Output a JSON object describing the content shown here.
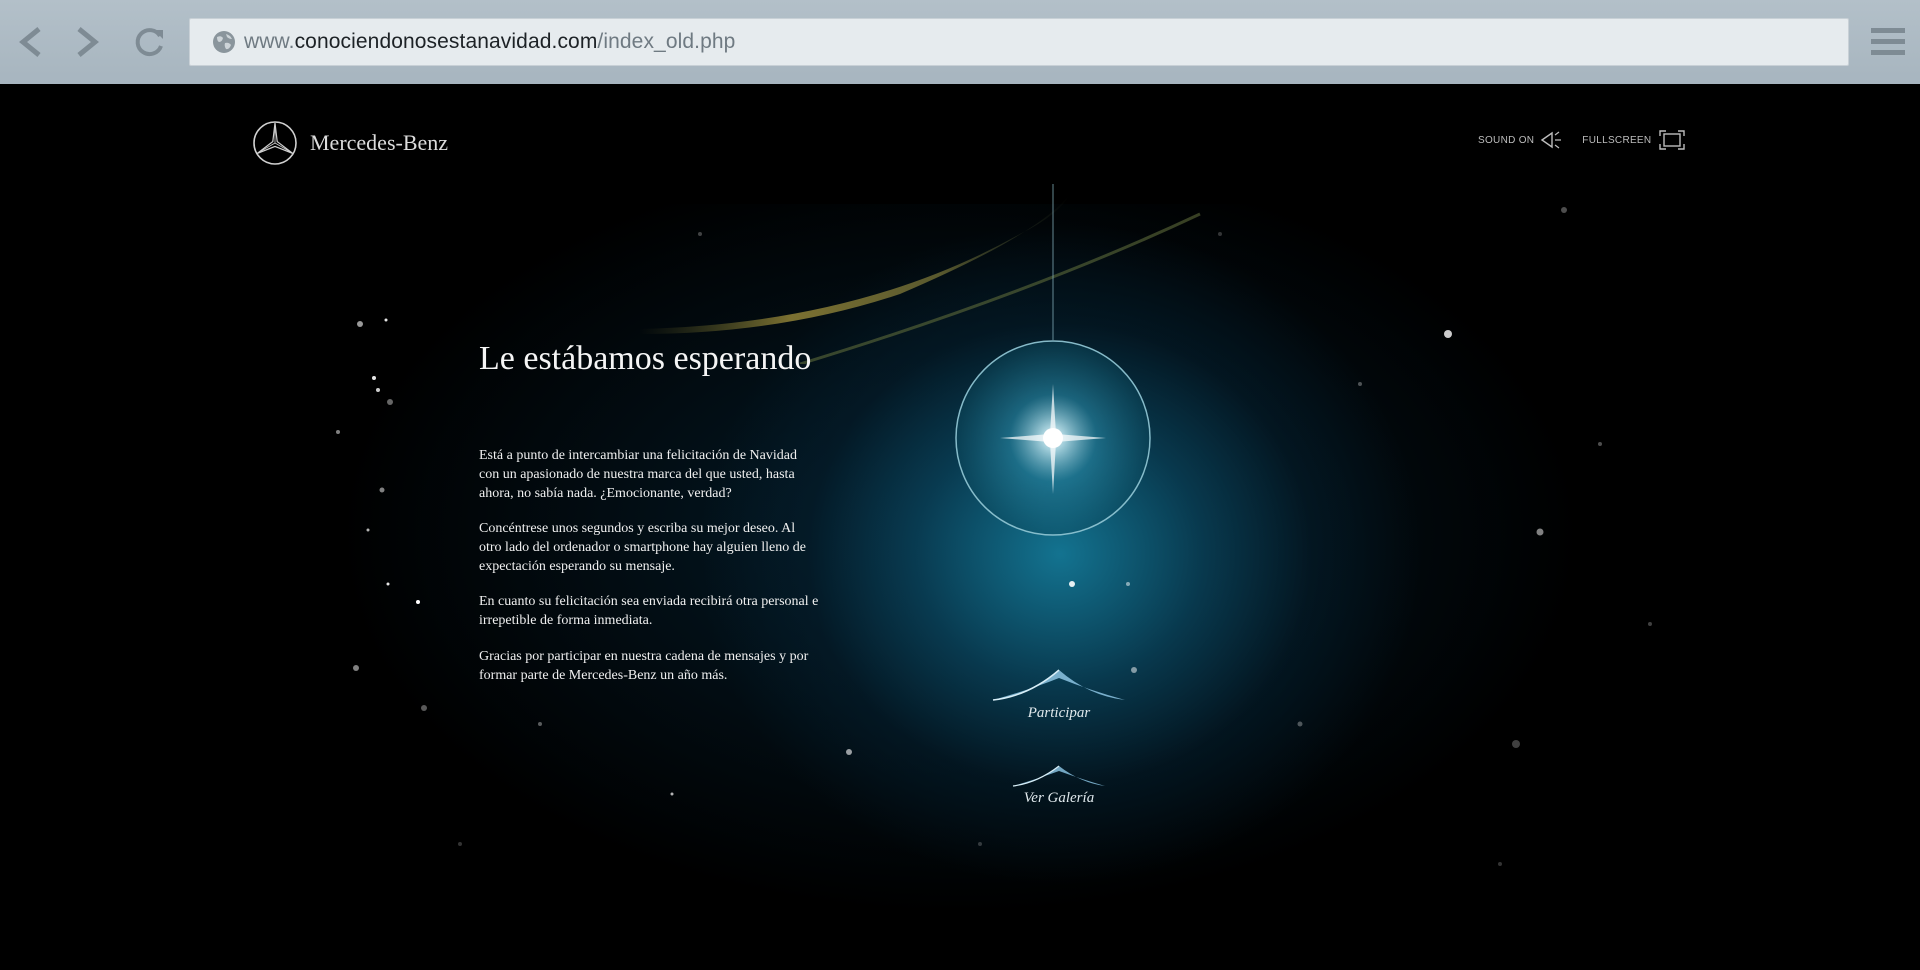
{
  "browser": {
    "url_host": "www.",
    "url_domain": "conociendonosestanavidad.com",
    "url_path": "/index_old.php"
  },
  "site": {
    "brand": "Mercedes-Benz",
    "sound_label": "SOUND ON",
    "fullscreen_label": "FULLSCREEN"
  },
  "content": {
    "headline": "Le estábamos esperando",
    "paragraphs": [
      "Está a punto de intercambiar una felicitación de Navidad con un apasionado de nuestra marca del que usted, hasta ahora, no sabía nada. ¿Emocionante, verdad?",
      "Concéntrese unos segundos y escriba su mejor deseo. Al otro lado del ordenador o smartphone hay alguien lleno de expectación esperando su mensaje.",
      "En cuanto su felicitación sea enviada recibirá otra personal e irrepetible de forma inmediata.",
      "Gracias por participar en nuestra cadena de mensajes y por formar parte de Mercedes-Benz un año más."
    ]
  },
  "actions": {
    "participar": "Participar",
    "galeria": "Ver Galería"
  },
  "colors": {
    "accent": "#1a7f9a",
    "background": "#000000",
    "browser_chrome": "#aab8c2"
  }
}
